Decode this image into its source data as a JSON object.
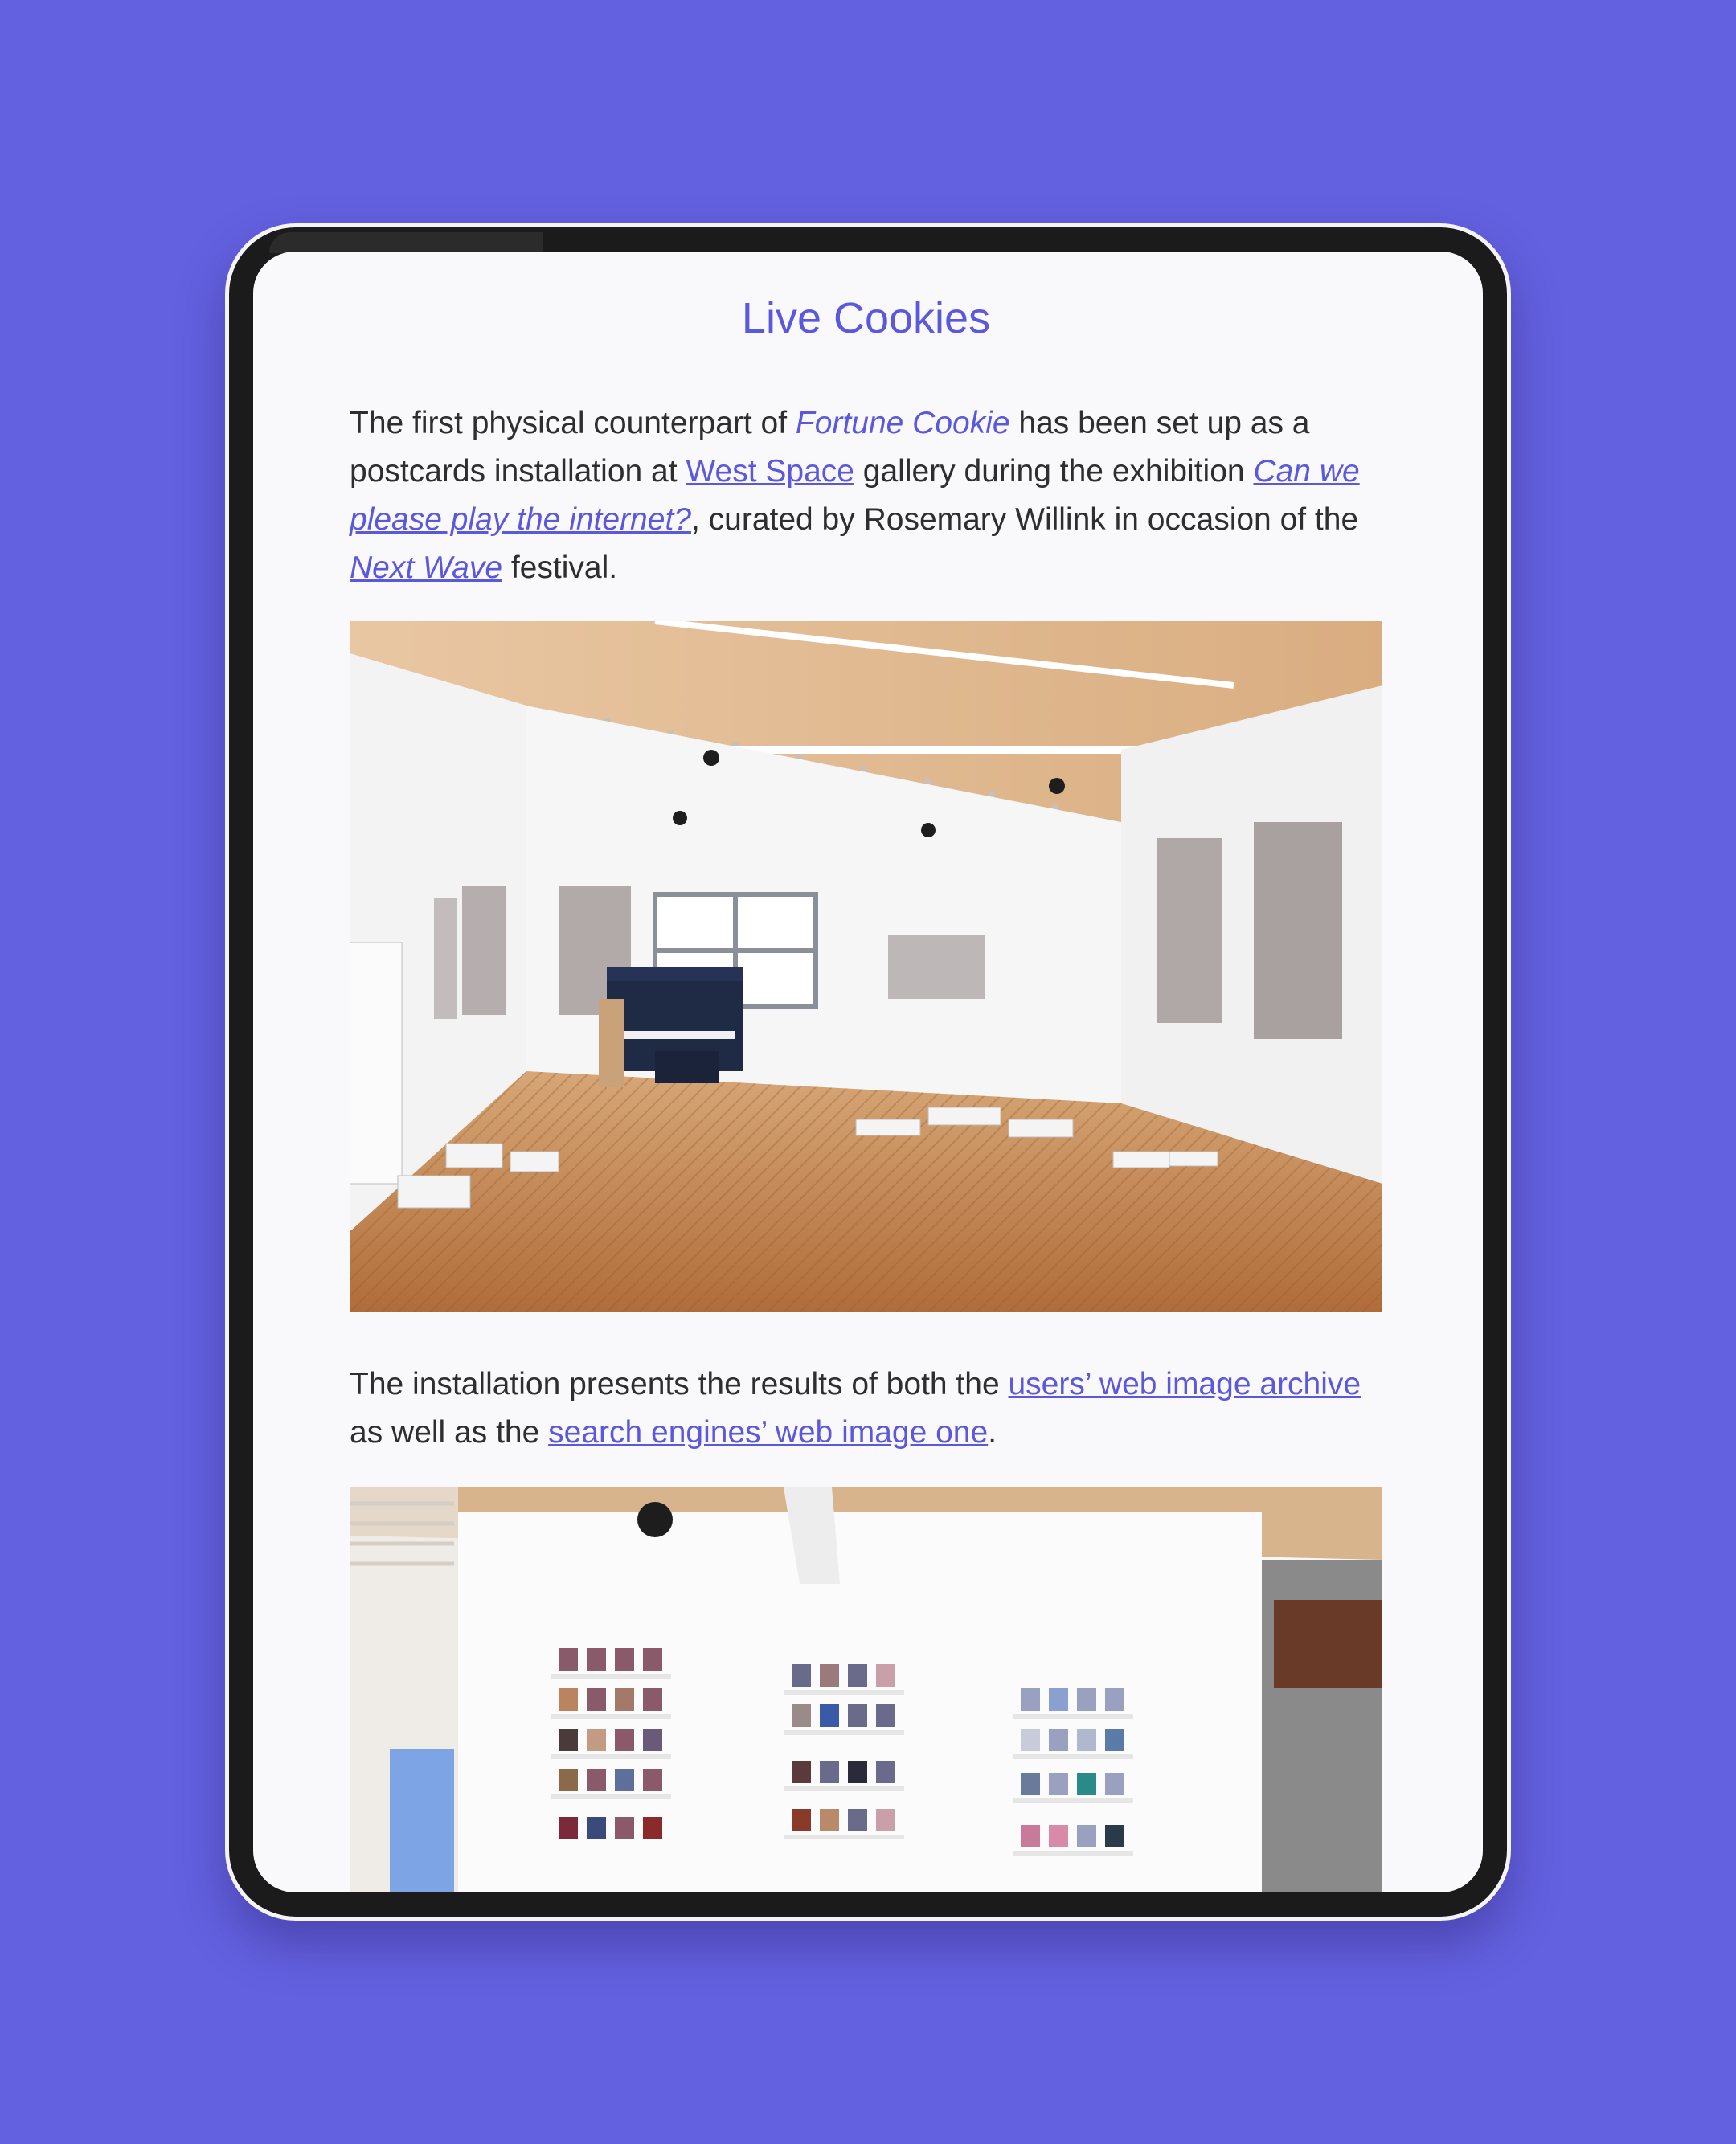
{
  "page": {
    "title": "Live Cookies"
  },
  "intro": {
    "t1": "The first physical counterpart of ",
    "fortune_cookie": "Fortune Cookie",
    "t2": " has been set up as a postcards installation at ",
    "west_space": "West Space",
    "t3": " gallery during the exhibition ",
    "exhibition": "Can we please play the internet?",
    "t4": ", curated by Rosemary Willink in occasion of the ",
    "next_wave": "Next Wave",
    "t5": " festival."
  },
  "second": {
    "t1": "The installation presents the results of both the ",
    "users_archive": "users’ web image archive",
    "t2": " as well as the ",
    "search_archive": "search engines’ web image one",
    "t3": "."
  },
  "colors": {
    "background": "#6461e0",
    "accent": "#5b58dd",
    "text": "#2e2e2e",
    "screen": "#f9f9fb"
  }
}
